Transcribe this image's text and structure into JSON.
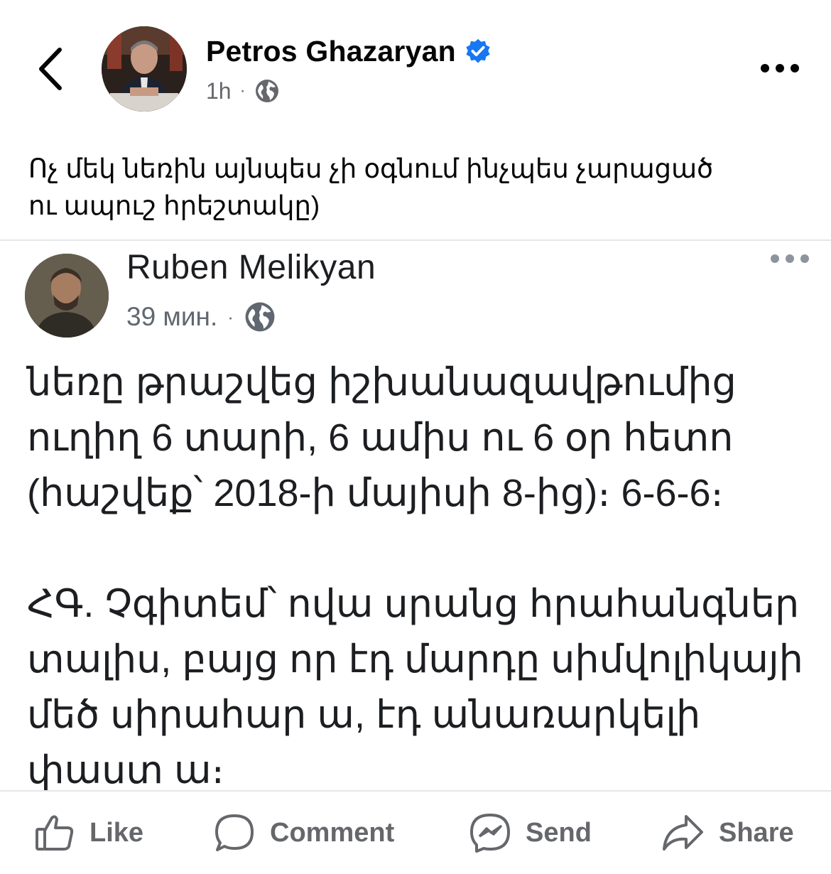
{
  "post": {
    "author": "Petros Ghazaryan",
    "time": "1h",
    "separator": "·",
    "caption_line1": "Ոչ մեկ նեռին այնպես չի օգնում ինչպես չարացած",
    "caption_line2": "ու ապուշ հրեշտակը)"
  },
  "shared_post": {
    "author": "Ruben Melikyan",
    "time": "39 мин.",
    "separator": "·",
    "line1": "նեռը թրաշվեց իշխանազավթումից",
    "line2": "ուղիղ 6 տարի, 6 ամիս ու 6 օր հետո",
    "line3": "(հաշվեք՝ 2018-ի մայիսի 8-ից)։ 6-6-6։",
    "line4": "ՀԳ. Չգիտեմ՝ ովա սրանց հրահանգներ",
    "line5": "տալիս, բայց որ էդ մարդը սիմվոլիկայի",
    "line6": "մեծ սիրահար ա, էդ անառարկելի",
    "line7": "փաստ ա։"
  },
  "actions": {
    "like": "Like",
    "comment": "Comment",
    "send": "Send",
    "share": "Share"
  },
  "colors": {
    "verified_blue": "#1877f2",
    "secondary_text": "#65676b",
    "divider": "#e4e6eb"
  },
  "icons": [
    "back-chevron-icon",
    "verified-badge-icon",
    "globe-icon",
    "more-options-icon",
    "like-icon",
    "comment-icon",
    "messenger-icon",
    "share-icon"
  ]
}
